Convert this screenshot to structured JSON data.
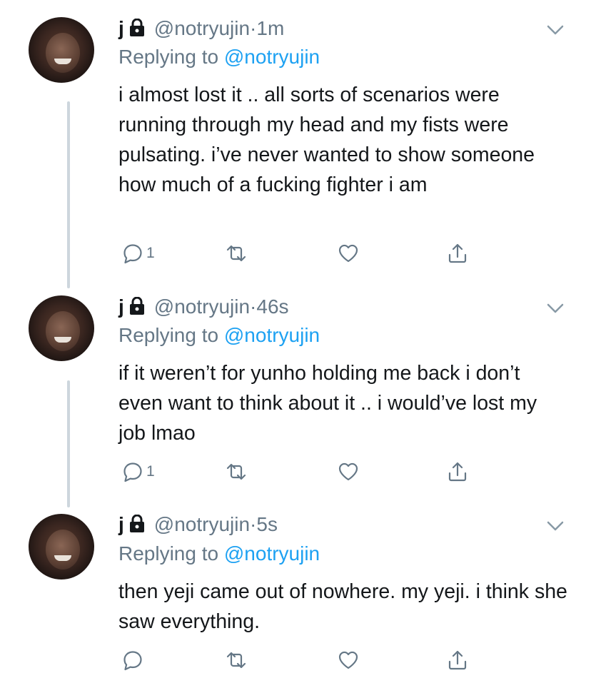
{
  "tweets": [
    {
      "name": "j",
      "handle": "@notryujin",
      "separator": "·",
      "time": "1m",
      "replying_prefix": "Replying to ",
      "replying_handle": "@notryujin",
      "text": "i almost lost it .. all sorts of scenarios were running through my head and my fists were pulsating. i’ve never wanted to show someone how much of a fucking fighter i am",
      "reply_count": "1"
    },
    {
      "name": "j",
      "handle": "@notryujin",
      "separator": "·",
      "time": "46s",
      "replying_prefix": "Replying to ",
      "replying_handle": "@notryujin",
      "text": "if it weren’t for yunho holding me back i don’t even want to think about it .. i would’ve lost my job lmao",
      "reply_count": "1"
    },
    {
      "name": "j",
      "handle": "@notryujin",
      "separator": "·",
      "time": "5s",
      "replying_prefix": "Replying to ",
      "replying_handle": "@notryujin",
      "text": "then yeji came out of nowhere. my yeji. i think she saw everything.",
      "reply_count": ""
    }
  ],
  "icons": {
    "lock": "lock-icon",
    "chevron": "chevron-down-icon",
    "reply": "reply-icon",
    "retweet": "retweet-icon",
    "like": "heart-icon",
    "share": "share-icon"
  },
  "colors": {
    "text": "#14171a",
    "muted": "#657786",
    "link": "#1da1f2",
    "thread_line": "#cdd6dd"
  }
}
